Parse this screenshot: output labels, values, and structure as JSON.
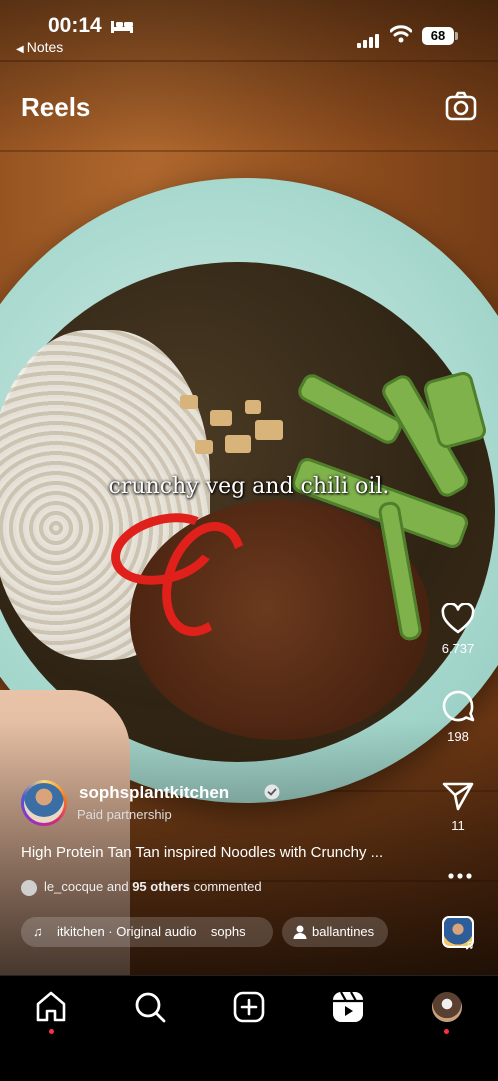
{
  "status_bar": {
    "time": "00:14",
    "back_label": "Notes",
    "battery": "68"
  },
  "header": {
    "title": "Reels",
    "camera_icon": "camera-icon"
  },
  "video": {
    "caption_overlay": "crunchy veg and chili oil."
  },
  "actions": {
    "likes": "6.737",
    "comments": "198",
    "shares": "11"
  },
  "post": {
    "username": "sophsplantkitchen",
    "paid_label": "Paid partnership",
    "description": "High Protein Tan Tan inspired Noodles with Crunchy ...",
    "commenter": "le_cocque",
    "commented_middle": " and ",
    "commented_count": "95 others",
    "commented_suffix": " commented",
    "audio_label": "itkitchen · Original audio    sophs",
    "tagged_user": "ballantines"
  },
  "nav": {
    "items": [
      "home-icon",
      "search-icon",
      "create-icon",
      "reels-icon",
      "profile-avatar"
    ]
  },
  "colors": {
    "accent_red": "#ff3040",
    "background": "#000000"
  }
}
